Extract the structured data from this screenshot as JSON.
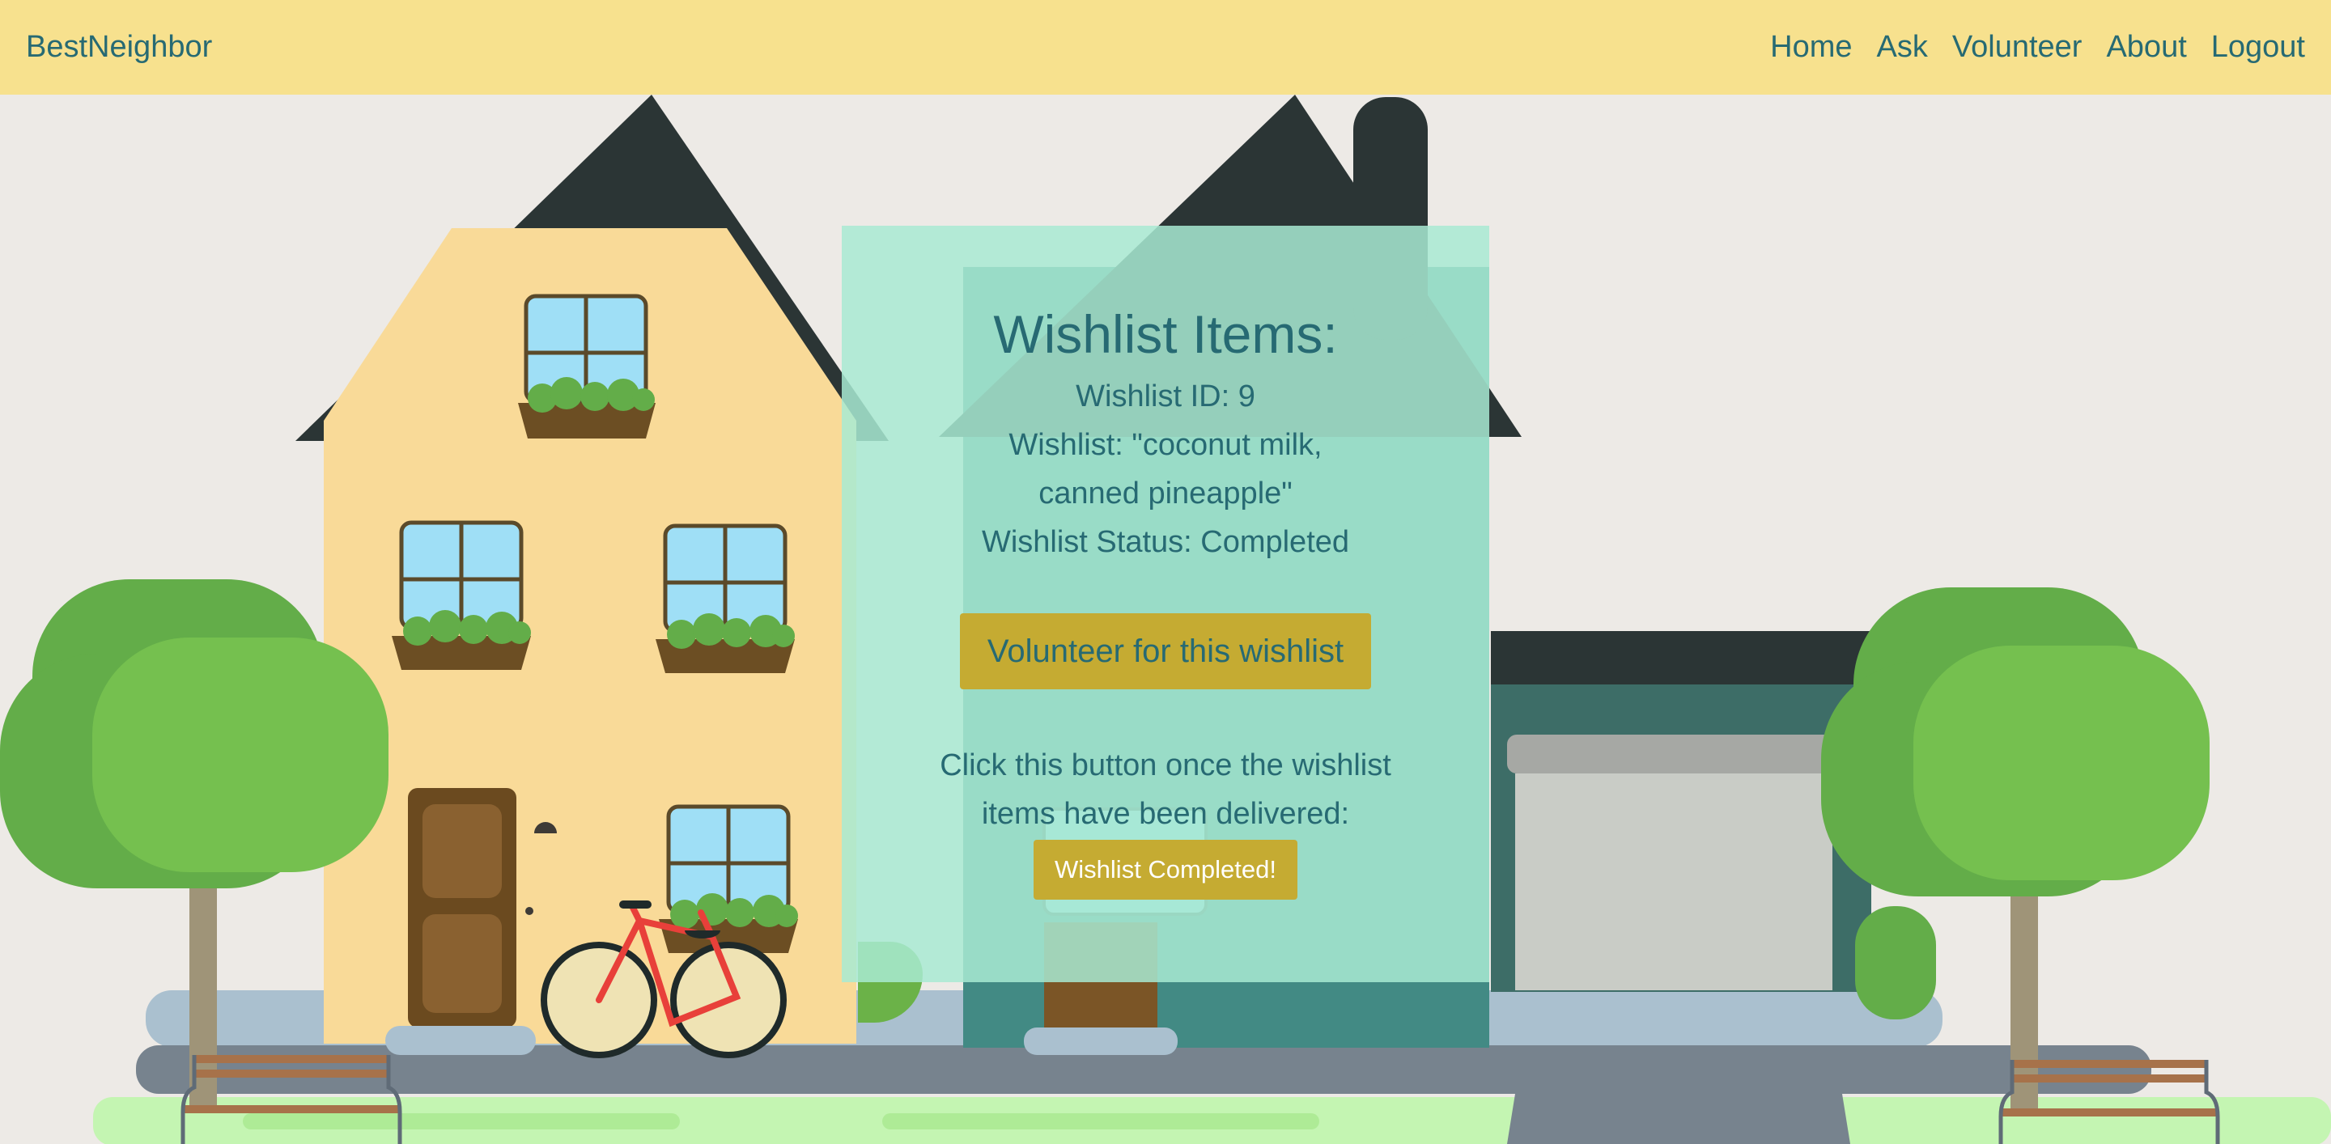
{
  "navbar": {
    "brand": "BestNeighbor",
    "links": [
      "Home",
      "Ask",
      "Volunteer",
      "About",
      "Logout"
    ]
  },
  "wishlist": {
    "title": "Wishlist Items:",
    "id_text": "Wishlist ID: 9",
    "items_text": "Wishlist: \"coconut milk, canned pineapple\"",
    "status_text": "Wishlist Status: Completed",
    "volunteer_button": "Volunteer for this wishlist",
    "instruction": "Click this button once the wishlist items have been delivered:",
    "complete_button": "Wishlist Completed!"
  },
  "colors": {
    "navbar_bg": "#f7e18e",
    "text": "#276a73",
    "card_bg": "#a8ead2",
    "button_bg": "#c5ab32",
    "page_bg": "#edeae6"
  }
}
